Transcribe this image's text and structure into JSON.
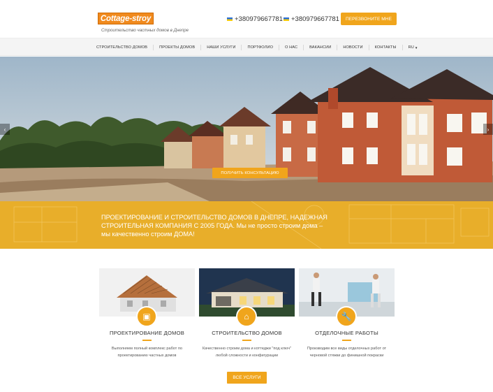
{
  "header": {
    "logo": "Cottage-stroy",
    "tagline": "Строительство частных домов в Днепре",
    "phones": [
      "+380979667781",
      "+380979667781"
    ],
    "callback_label": "ПЕРЕЗВОНИТЕ МНЕ"
  },
  "nav": {
    "items": [
      "СТРОИТЕЛЬСТВО ДОМОВ",
      "ПРОЕКТЫ ДОМОВ",
      "НАШИ УСЛУГИ",
      "ПОРТФОЛИО",
      "О НАС",
      "ВАКАНСИИ",
      "НОВОСТИ",
      "КОНТАКТЫ",
      "RU"
    ]
  },
  "hero": {
    "consult_label": "ПОЛУЧИТЬ КОНСУЛЬТАЦИЮ",
    "prev_icon": "chevron-left-icon",
    "next_icon": "chevron-right-icon"
  },
  "banner": {
    "text": "ПРОЕКТИРОВАНИЕ И СТРОИТЕЛЬСТВО ДОМОВ В ДНЕПРЕ, НАДЕЖНАЯ СТРОИТЕЛЬНАЯ КОМПАНИЯ С 2005 ГОДА. Мы не просто строим дома – мы качественно строим ДОМА!"
  },
  "services": [
    {
      "title": "ПРОЕКТИРОВАНИЕ ДОМОВ",
      "desc": "Выполняем полный комплекс работ по проектированию частных домов",
      "icon": "blueprint-icon"
    },
    {
      "title": "СТРОИТЕЛЬСТВО ДОМОВ",
      "desc": "Качественно строим дома и коттеджи \"под ключ\" любой сложности и конфигурации",
      "icon": "house-icon"
    },
    {
      "title": "ОТДЕЛОЧНЫЕ РАБОТЫ",
      "desc": "Производим все виды отделочных работ от черновой стяжки до финишной покраски",
      "icon": "wrench-icon"
    }
  ],
  "all_services_label": "ВСЕ УСЛУГИ",
  "colors": {
    "accent": "#f0a51c",
    "banner": "#e8ae2a",
    "logo": "#f08a1e"
  }
}
